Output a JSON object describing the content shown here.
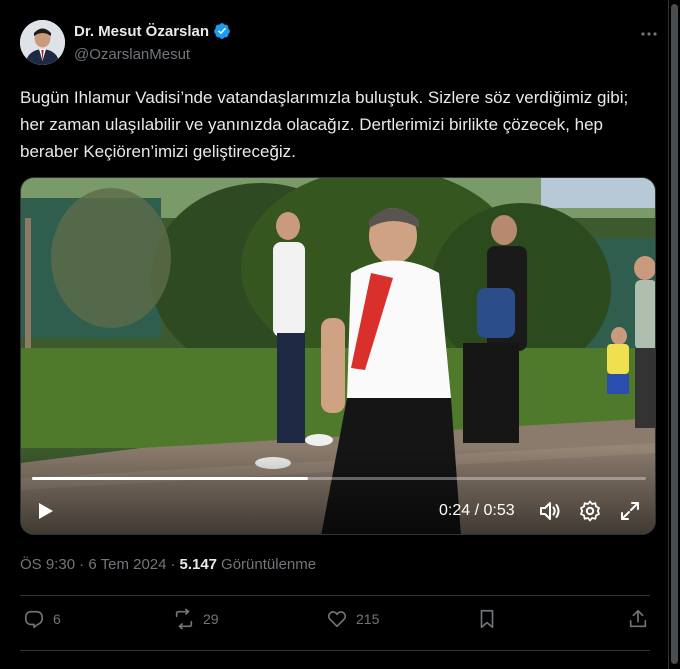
{
  "author": {
    "name": "Dr. Mesut Özarslan",
    "handle": "@OzarslanMesut",
    "verified_icon": "verified-badge-icon"
  },
  "tweet": {
    "text": "Bugün Ihlamur Vadisi’nde vatandaşlarımızla buluştuk. Sizlere söz verdiğimiz gibi; her zaman ulaşılabilir ve yanınızda olacağız. Dertlerimizi birlikte çözecek, hep beraber Keçiören’imizi geliştireceğiz."
  },
  "video": {
    "time_label": "0:24 / 0:53",
    "progress_fraction": 0.45
  },
  "meta": {
    "timestamp": "ÖS 9:30 · 6 Tem 2024",
    "separator": "·",
    "views_count": "5.147",
    "views_label": "Görüntülenme"
  },
  "actions": {
    "replies": "6",
    "reposts": "29",
    "likes": "215"
  },
  "colors": {
    "background": "#000000",
    "text": "#e7e9ea",
    "muted": "#71767b",
    "verified": "#1d9bf0"
  }
}
